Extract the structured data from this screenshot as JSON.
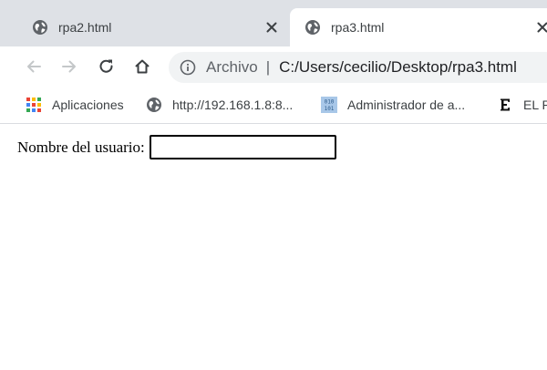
{
  "tabs": [
    {
      "label": "rpa2.html",
      "active": false,
      "favicon": "globe-icon"
    },
    {
      "label": "rpa3.html",
      "active": true,
      "favicon": "globe-icon"
    }
  ],
  "toolbar": {
    "back_icon": "back-arrow-icon",
    "forward_icon": "forward-arrow-icon",
    "reload_icon": "reload-icon",
    "home_icon": "home-icon"
  },
  "address_bar": {
    "security_icon": "info-icon",
    "scheme_label": "Archivo",
    "separator": "|",
    "url": "C:/Users/cecilio/Desktop/rpa3.html"
  },
  "bookmarks": [
    {
      "label": "Aplicaciones",
      "icon": "apps-grid-icon"
    },
    {
      "label": "http://192.168.1.8:8...",
      "icon": "globe-icon"
    },
    {
      "label": "Administrador de a...",
      "icon": "binary-icon"
    },
    {
      "label": "EL P",
      "icon": "el-pais-icon"
    }
  ],
  "page": {
    "form": {
      "username_label": "Nombre del usuario:",
      "username_value": "",
      "username_placeholder": ""
    }
  },
  "colors": {
    "tabstrip_bg": "#dee1e6",
    "omnibox_bg": "#f1f3f4",
    "text_primary": "#202124",
    "text_secondary": "#5f6368",
    "icon_globe": "#5f6368",
    "apps_red": "#ea4335",
    "apps_green": "#34a853",
    "apps_blue": "#4285f4",
    "apps_yellow": "#fbbc04",
    "binary_icon_bg": "#a8c7e8"
  }
}
